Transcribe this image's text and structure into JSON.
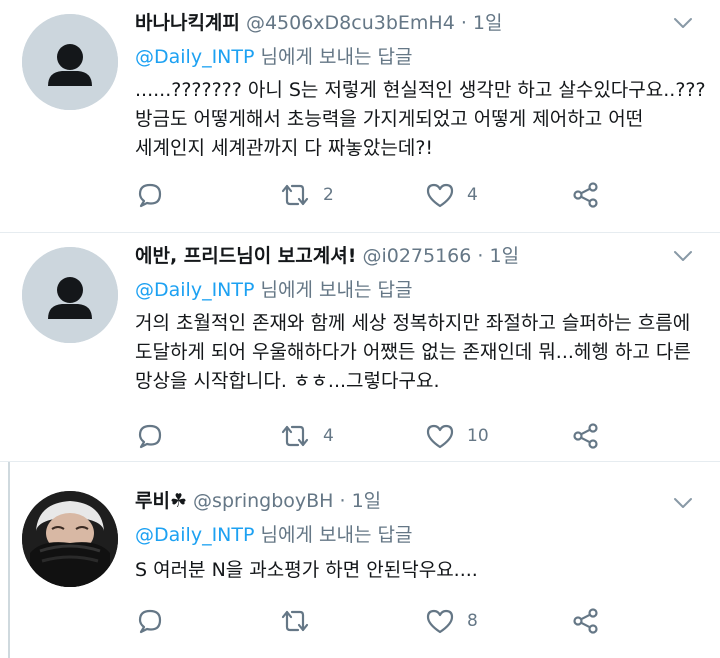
{
  "reply_prefix": "@Daily_INTP",
  "reply_suffix": "님에게 보내는 답글",
  "tweets": [
    {
      "name": "바나나킥계피",
      "handle": "@4506xD8cu3bEmH4",
      "dot": "·",
      "time": "1일",
      "lines": [
        "......??????? 아니 S는 저렇게 현실적인 생각만 하고 살수있다구요..???",
        "방금도 어떻게해서 초능력을 가지게되었고 어떻게 제어하고 어떤",
        "세계인지 세계관까지 다 짜놓았는데?!"
      ],
      "retweets": "2",
      "likes": "4",
      "avatar": "default-avatar"
    },
    {
      "name": "에반, 프리드님이 보고계셔!",
      "handle": "@i0275166",
      "dot": "·",
      "time": "1일",
      "lines": [
        "거의 초월적인 존재와 함께 세상 정복하지만 좌절하고 슬퍼하는 흐름에",
        "도달하게 되어  우울해하다가 어쨌든 없는 존재인데 뭐...헤헹 하고 다른",
        "망상을 시작합니다. ㅎㅎ...그렇다구요."
      ],
      "retweets": "4",
      "likes": "10",
      "avatar": "default-avatar"
    },
    {
      "name": "루비☘",
      "handle": "@springboyBH",
      "dot": "·",
      "time": "1일",
      "lines": [
        "S 여러분 N을 과소평가 하면 안된닥우요...."
      ],
      "retweets": "",
      "likes": "8",
      "avatar": "photo-avatar"
    }
  ]
}
